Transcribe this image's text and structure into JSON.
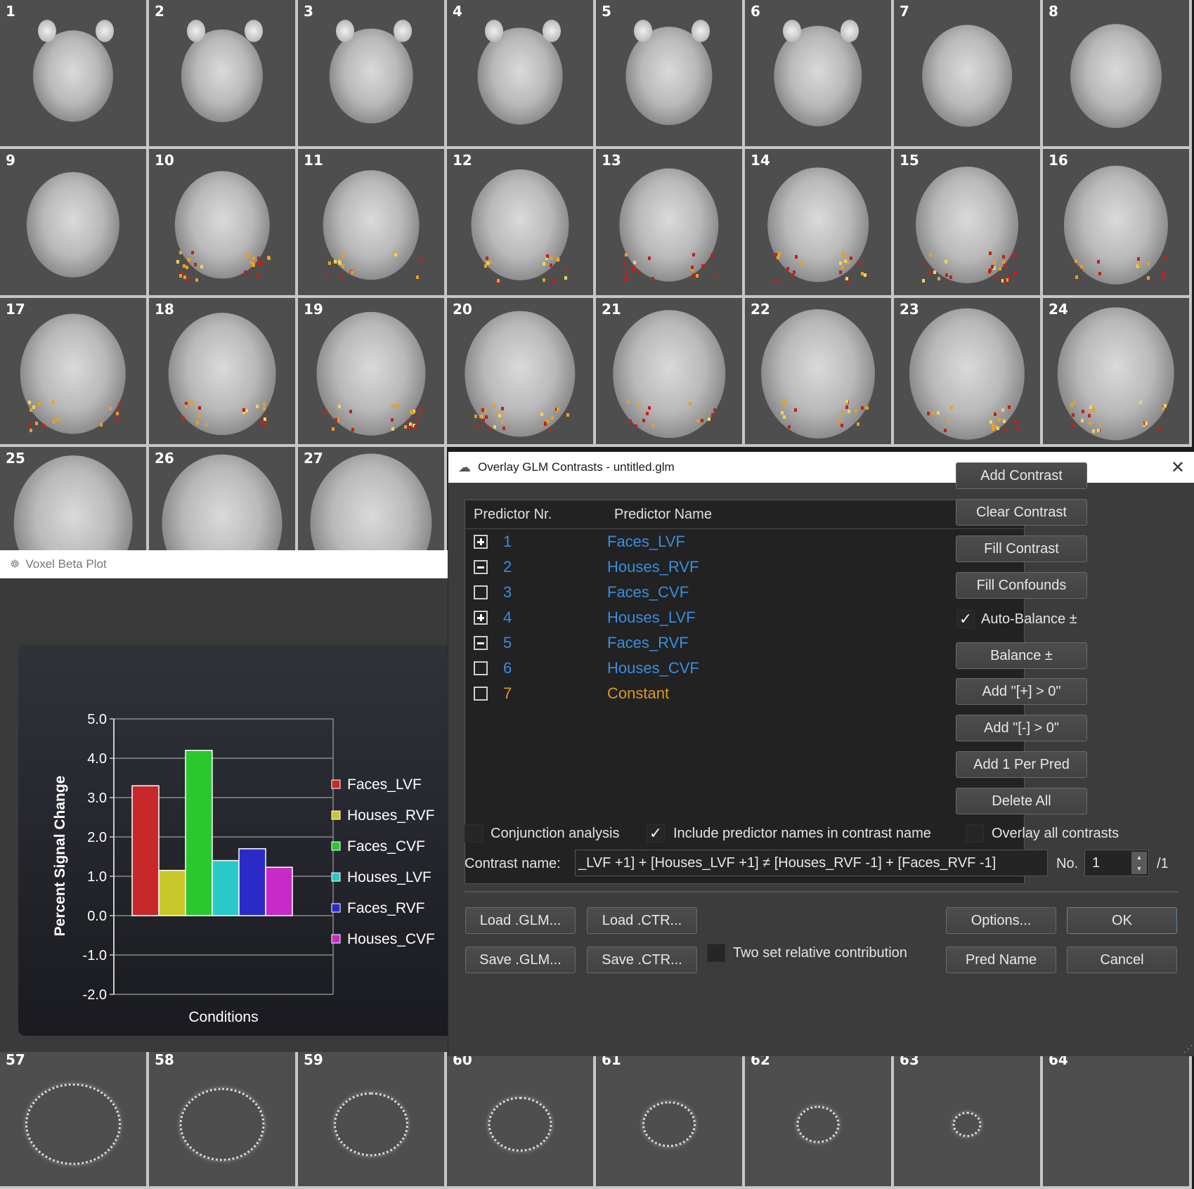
{
  "mosaic": {
    "top_slices": [
      "1",
      "2",
      "3",
      "4",
      "5",
      "6",
      "7",
      "8",
      "9",
      "10",
      "11",
      "12",
      "13",
      "14",
      "15",
      "16",
      "17",
      "18",
      "19",
      "20",
      "21",
      "22",
      "23",
      "24",
      "25",
      "26",
      "27"
    ],
    "bottom_slices": [
      "57",
      "58",
      "59",
      "60",
      "61",
      "62",
      "63",
      "64"
    ]
  },
  "beta_plot": {
    "title": "Voxel Beta Plot",
    "legend": [
      "Faces_LVF",
      "Houses_RVF",
      "Faces_CVF",
      "Houses_LVF",
      "Faces_RVF",
      "Houses_CVF"
    ]
  },
  "chart_data": {
    "type": "bar",
    "categories": [
      "Faces_LVF",
      "Houses_RVF",
      "Faces_CVF",
      "Houses_LVF",
      "Faces_RVF",
      "Houses_CVF"
    ],
    "values": [
      3.3,
      1.15,
      4.2,
      1.4,
      1.7,
      1.23
    ],
    "colors": [
      "#c8282a",
      "#c8c82a",
      "#2ac82e",
      "#2ac8c8",
      "#2a2ac8",
      "#c82ac8"
    ],
    "xlabel": "Conditions",
    "ylabel": "Percent Signal Change",
    "ylim": [
      -2.0,
      5.0
    ],
    "yticks": [
      "5.0",
      "4.0",
      "3.0",
      "2.0",
      "1.0",
      "0.0",
      "-1.0",
      "-2.0"
    ],
    "grid": true,
    "legend_position": "right"
  },
  "glm": {
    "title": "Overlay GLM Contrasts - untitled.glm",
    "col_nr": "Predictor Nr.",
    "col_name": "Predictor Name",
    "predictors": [
      {
        "nr": "1",
        "name": "Faces_LVF",
        "state": "plus",
        "color": "blue"
      },
      {
        "nr": "2",
        "name": "Houses_RVF",
        "state": "minus",
        "color": "blue"
      },
      {
        "nr": "3",
        "name": "Faces_CVF",
        "state": "none",
        "color": "blue"
      },
      {
        "nr": "4",
        "name": "Houses_LVF",
        "state": "plus",
        "color": "blue"
      },
      {
        "nr": "5",
        "name": "Faces_RVF",
        "state": "minus",
        "color": "blue"
      },
      {
        "nr": "6",
        "name": "Houses_CVF",
        "state": "none",
        "color": "blue"
      },
      {
        "nr": "7",
        "name": "Constant",
        "state": "none",
        "color": "gold"
      }
    ],
    "side_buttons": {
      "add_contrast": "Add Contrast",
      "clear_contrast": "Clear Contrast",
      "fill_contrast": "Fill Contrast",
      "fill_confounds": "Fill Confounds",
      "auto_balance": "Auto-Balance ±",
      "balance": "Balance ±",
      "add_plus": "Add \"[+] > 0\"",
      "add_minus": "Add \"[-]  > 0\"",
      "add_one_per_pred": "Add 1 Per Pred",
      "delete_all": "Delete All"
    },
    "conjunction_label": "Conjunction analysis",
    "include_names_label": "Include predictor names in contrast name",
    "overlay_all_label": "Overlay all contrasts",
    "contrast_name_label": "Contrast name:",
    "contrast_name_value": "_LVF +1] + [Houses_LVF +1] ≠ [Houses_RVF -1] + [Faces_RVF -1]",
    "no_label": "No.",
    "no_value": "1",
    "no_total": "/1",
    "load_glm": "Load .GLM...",
    "load_ctr": "Load .CTR...",
    "save_glm": "Save .GLM...",
    "save_ctr": "Save .CTR...",
    "two_set_label": "Two set relative contribution",
    "options": "Options...",
    "ok": "OK",
    "pred_name": "Pred  Name",
    "cancel": "Cancel"
  }
}
